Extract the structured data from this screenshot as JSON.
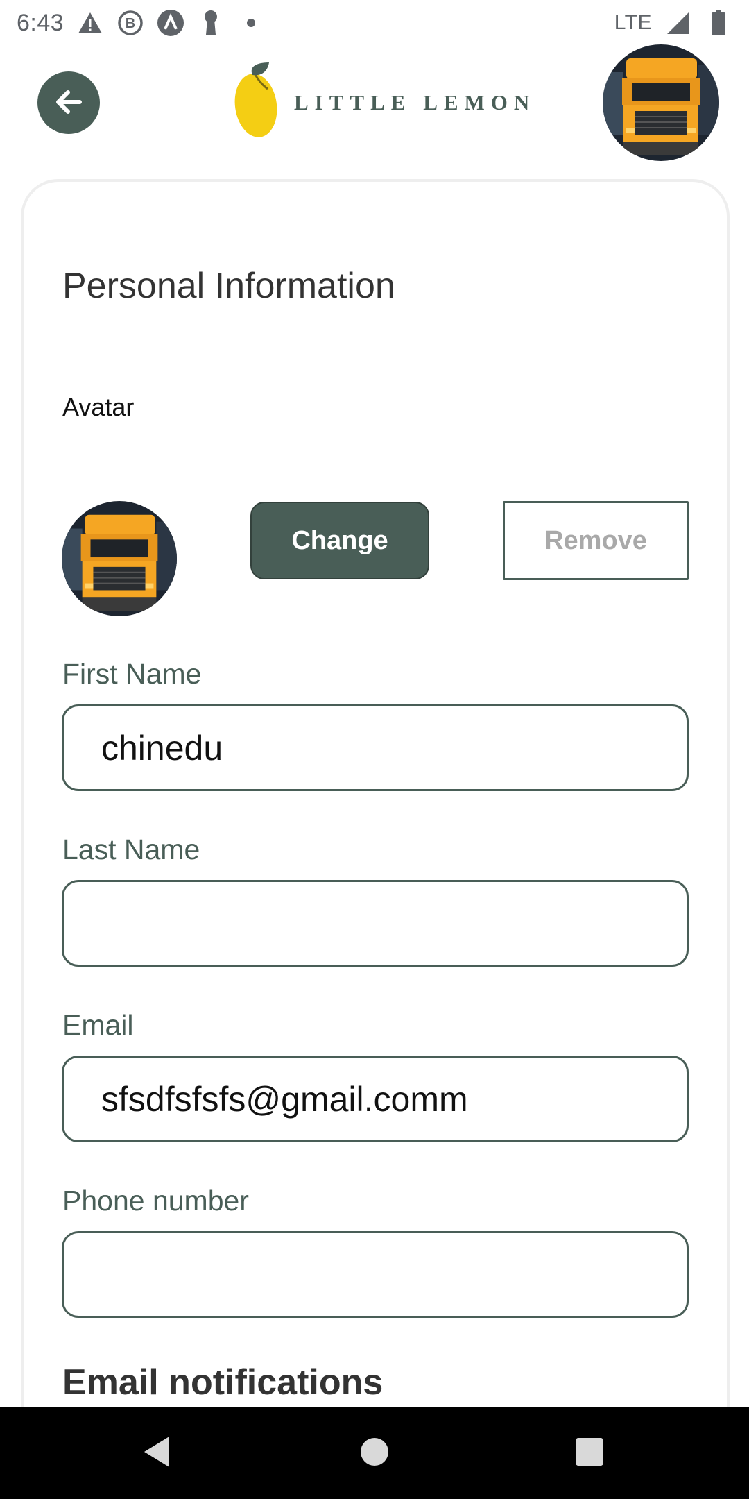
{
  "status_bar": {
    "time": "6:43",
    "network": "LTE"
  },
  "header": {
    "logo_text": "LITTLE LEMON"
  },
  "profile": {
    "section_title": "Personal Information",
    "avatar_label": "Avatar",
    "change_label": "Change",
    "remove_label": "Remove",
    "fields": {
      "first_name": {
        "label": "First Name",
        "value": "chinedu"
      },
      "last_name": {
        "label": "Last Name",
        "value": ""
      },
      "email": {
        "label": "Email",
        "value": "sfsdfsfsfs@gmail.comm"
      },
      "phone": {
        "label": "Phone number",
        "value": ""
      }
    },
    "notifications_title": "Email notifications"
  },
  "colors": {
    "primary": "#495E57",
    "lemon": "#F4CE14",
    "truck_orange": "#F5A623"
  },
  "icons": [
    "warning-icon",
    "b-icon",
    "a-icon",
    "keyhole-icon",
    "dot-icon",
    "signal-icon",
    "battery-icon",
    "back-arrow-icon",
    "lemon-icon",
    "nav-back-icon",
    "nav-home-icon",
    "nav-recents-icon"
  ]
}
